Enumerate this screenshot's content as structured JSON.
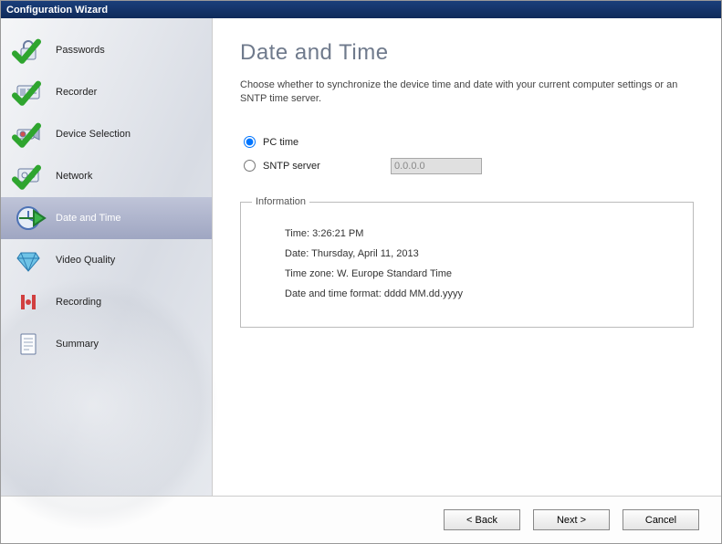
{
  "window": {
    "title": "Configuration Wizard"
  },
  "sidebar": {
    "items": [
      {
        "label": "Passwords"
      },
      {
        "label": "Recorder"
      },
      {
        "label": "Device Selection"
      },
      {
        "label": "Network"
      },
      {
        "label": "Date and Time"
      },
      {
        "label": "Video Quality"
      },
      {
        "label": "Recording"
      },
      {
        "label": "Summary"
      }
    ]
  },
  "page": {
    "title": "Date and Time",
    "description": "Choose whether to synchronize the device time and date with your current computer settings or an SNTP time server."
  },
  "options": {
    "pc_time_label": "PC time",
    "sntp_label": "SNTP server",
    "sntp_value": "0.0.0.0",
    "selected": "pc"
  },
  "info": {
    "legend": "Information",
    "time_label": "Time:",
    "time_value": "3:26:21 PM",
    "date_label": "Date:",
    "date_value": "Thursday, April 11, 2013",
    "tz_label": "Time zone:",
    "tz_value": "W. Europe Standard Time",
    "fmt_label": "Date and time format:",
    "fmt_value": "dddd MM.dd.yyyy"
  },
  "footer": {
    "back": "< Back",
    "next": "Next >",
    "cancel": "Cancel"
  }
}
